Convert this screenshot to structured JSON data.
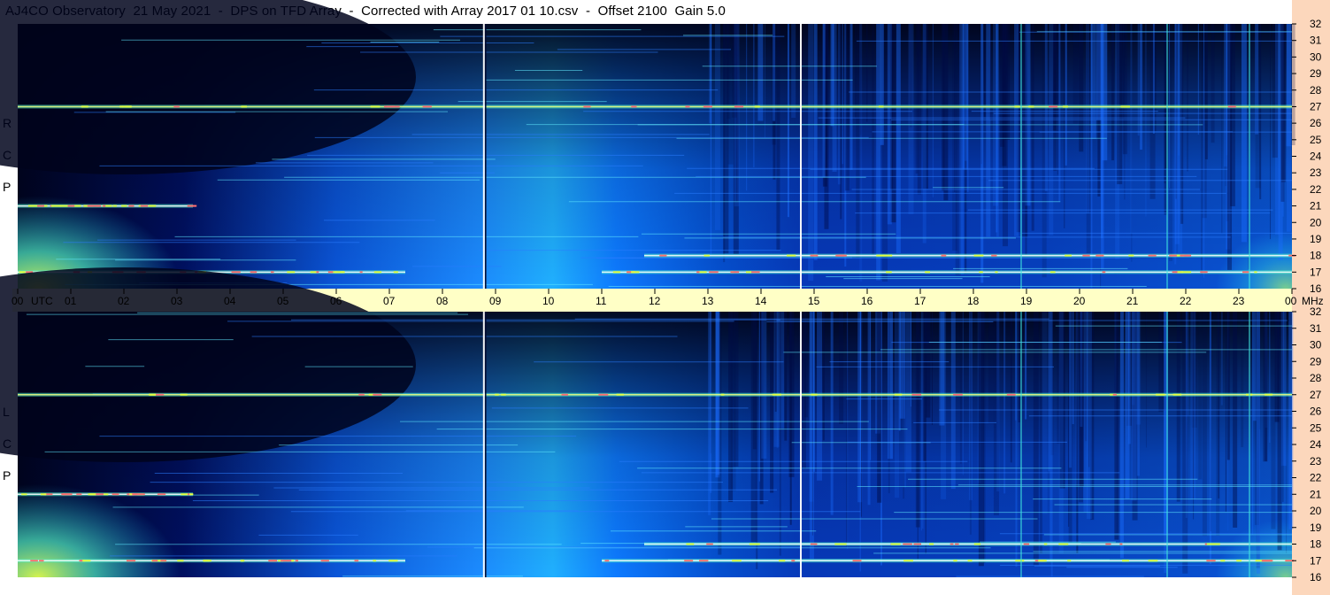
{
  "title": "AJ4CO Observatory  21 May 2021  -  DPS on TFD Array  -  Corrected with Array 2017 01 10.csv  -  Offset 2100  Gain 5.0",
  "panels": [
    {
      "polarization": [
        "R",
        "C",
        "P"
      ]
    },
    {
      "polarization": [
        "L",
        "C",
        "P"
      ]
    }
  ],
  "time_axis": {
    "first_label": "00",
    "unit": "UTC",
    "labels": [
      "01",
      "02",
      "03",
      "04",
      "05",
      "06",
      "07",
      "08",
      "09",
      "10",
      "11",
      "12",
      "13",
      "14",
      "15",
      "16",
      "17",
      "18",
      "19",
      "20",
      "21",
      "22",
      "23"
    ],
    "last_label": "00",
    "freq_unit": "MHz"
  },
  "chart_data": {
    "type": "heatmap",
    "title": "AJ4CO Observatory  21 May 2021  -  DPS on TFD Array  -  Corrected with Array 2017 01 10.csv  -  Offset 2100  Gain 5.0",
    "x_unit": "UTC",
    "x_ticks": [
      "00",
      "01",
      "02",
      "03",
      "04",
      "05",
      "06",
      "07",
      "08",
      "09",
      "10",
      "11",
      "12",
      "13",
      "14",
      "15",
      "16",
      "17",
      "18",
      "19",
      "20",
      "21",
      "22",
      "23",
      "00"
    ],
    "xlim_hours": [
      0,
      24
    ],
    "y_unit": "MHz",
    "y_ticks": [
      16,
      17,
      18,
      19,
      20,
      21,
      22,
      23,
      24,
      25,
      26,
      27,
      28,
      29,
      30,
      31,
      32
    ],
    "ylim": [
      16,
      32
    ],
    "panels": [
      "RCP",
      "LCP"
    ],
    "colormap": [
      "#000018",
      "#000a55",
      "#0033cc",
      "#0a7bff",
      "#1cc0ff",
      "#50f0c8",
      "#d8ff40",
      "#ff7070",
      "#ffffff"
    ],
    "background_color": "#00031e",
    "axis_color": "#fcd7bc",
    "time_band_color": "#ffffc6",
    "bright_bands": [
      {
        "freq": 27,
        "start": 0,
        "end": 24
      },
      {
        "freq": 17,
        "start": 0,
        "end": 7.3
      },
      {
        "freq": 17,
        "start": 11,
        "end": 24
      },
      {
        "freq": 21,
        "start": 0,
        "end": 3.3
      },
      {
        "freq": 18,
        "start": 11.8,
        "end": 24
      }
    ],
    "vertical_events": [
      8.78,
      14.75,
      18.9,
      21.65,
      23.2
    ]
  }
}
